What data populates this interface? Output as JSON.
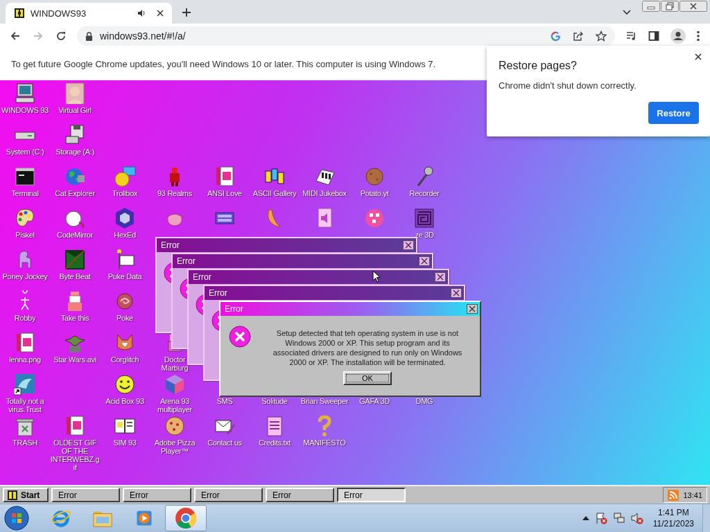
{
  "browser": {
    "tab": {
      "title": "WINDOWS93",
      "audio": true
    },
    "url": "windows93.net/#!/a/",
    "infobar": "To get future Google Chrome updates, you'll need Windows 10 or later. This computer is using Windows 7.",
    "restore_popup": {
      "title": "Restore pages?",
      "message": "Chrome didn't shut down correctly.",
      "button": "Restore"
    }
  },
  "desktop": {
    "icon_rows": [
      [
        {
          "kind": "app",
          "label": "WINDOWS 93"
        },
        {
          "kind": "app",
          "label": "Virtual Girl"
        }
      ],
      [
        {
          "kind": "app",
          "label": "System (C:)"
        },
        {
          "kind": "app",
          "label": "Storage (A:)"
        }
      ],
      [
        {
          "kind": "app",
          "label": "Terminal"
        },
        {
          "kind": "app",
          "label": "Cat Explorer"
        },
        {
          "kind": "app",
          "label": "Trollbox"
        },
        {
          "kind": "app",
          "label": "93 Realms"
        },
        {
          "kind": "app",
          "label": "ANSI Love"
        },
        {
          "kind": "app",
          "label": "ASCII Gallery"
        },
        {
          "kind": "app",
          "label": "MIDI Jukebox"
        },
        {
          "kind": "app",
          "label": "Potato.yt"
        },
        {
          "kind": "app",
          "label": "Recorder"
        }
      ],
      [
        {
          "kind": "app",
          "label": "Piskel"
        },
        {
          "kind": "app",
          "label": "CodeMirror"
        },
        {
          "kind": "app",
          "label": "HexEd"
        },
        {
          "kind": "icon_only"
        },
        {
          "kind": "icon_only"
        },
        {
          "kind": "icon_only"
        },
        {
          "kind": "icon_only"
        },
        {
          "kind": "icon_only"
        },
        {
          "kind": "app",
          "label": "ze 3D"
        }
      ],
      [
        {
          "kind": "app",
          "label": "Poney Jockey"
        },
        {
          "kind": "app",
          "label": "Byte Beat"
        },
        {
          "kind": "app",
          "label": "Puke Data"
        }
      ],
      [
        {
          "kind": "app",
          "label": "Robby"
        },
        {
          "kind": "app",
          "label": "Take this"
        },
        {
          "kind": "app",
          "label": "Poke"
        }
      ],
      [
        {
          "kind": "app",
          "label": "lenna.png"
        },
        {
          "kind": "app",
          "label": "Star Wars.avi"
        },
        {
          "kind": "app",
          "label": "Corglitch"
        },
        {
          "kind": "app",
          "label": "Doctor Marburg"
        }
      ],
      [
        {
          "kind": "app",
          "label": "Totally not a virus.Trust"
        },
        {
          "kind": "blank"
        },
        {
          "kind": "app",
          "label": "Acid Box 93"
        },
        {
          "kind": "app",
          "label": "Arena 93 multiplayer"
        },
        {
          "kind": "label_only",
          "label": "SMS"
        },
        {
          "kind": "label_only",
          "label": "Solitude"
        },
        {
          "kind": "label_only",
          "label": "Brian Sweeper"
        },
        {
          "kind": "label_only",
          "label": "GAFA 3D"
        },
        {
          "kind": "label_only",
          "label": "DMG"
        }
      ],
      [
        {
          "kind": "app",
          "label": "TRASH"
        },
        {
          "kind": "app",
          "label": "OLDEST GIF OF THE INTERWEBZ.gif"
        },
        {
          "kind": "app",
          "label": "SIM 93"
        },
        {
          "kind": "app",
          "label": "Adobe Pizza Player™"
        },
        {
          "kind": "app",
          "label": "Contact us"
        },
        {
          "kind": "app",
          "label": "Credits.txt"
        },
        {
          "kind": "app",
          "label": "MANIFESTO"
        }
      ]
    ]
  },
  "dialogs": [
    {
      "title": "Error",
      "active": false
    },
    {
      "title": "Error",
      "active": false
    },
    {
      "title": "Error",
      "active": false
    },
    {
      "title": "Error",
      "active": false
    },
    {
      "title": "Error",
      "active": true,
      "message": "Setup detected that teh operating system in use is not Windows 2000 or XP. This setup program and its associated drivers are designed to run only on Windows 2000 or XP. The installation will be terminated.",
      "button": "OK"
    }
  ],
  "w93_taskbar": {
    "start": "Start",
    "tasks": [
      {
        "label": "Error",
        "selected": false
      },
      {
        "label": "Error",
        "selected": false
      },
      {
        "label": "Error",
        "selected": false
      },
      {
        "label": "Error",
        "selected": false
      },
      {
        "label": "Error",
        "selected": true
      }
    ],
    "clock": "13:41"
  },
  "win7_taskbar": {
    "apps": [
      {
        "selected": false
      },
      {
        "selected": false
      },
      {
        "selected": false
      },
      {
        "selected": true
      }
    ],
    "time": "1:41 PM",
    "date": "11/21/2023"
  }
}
